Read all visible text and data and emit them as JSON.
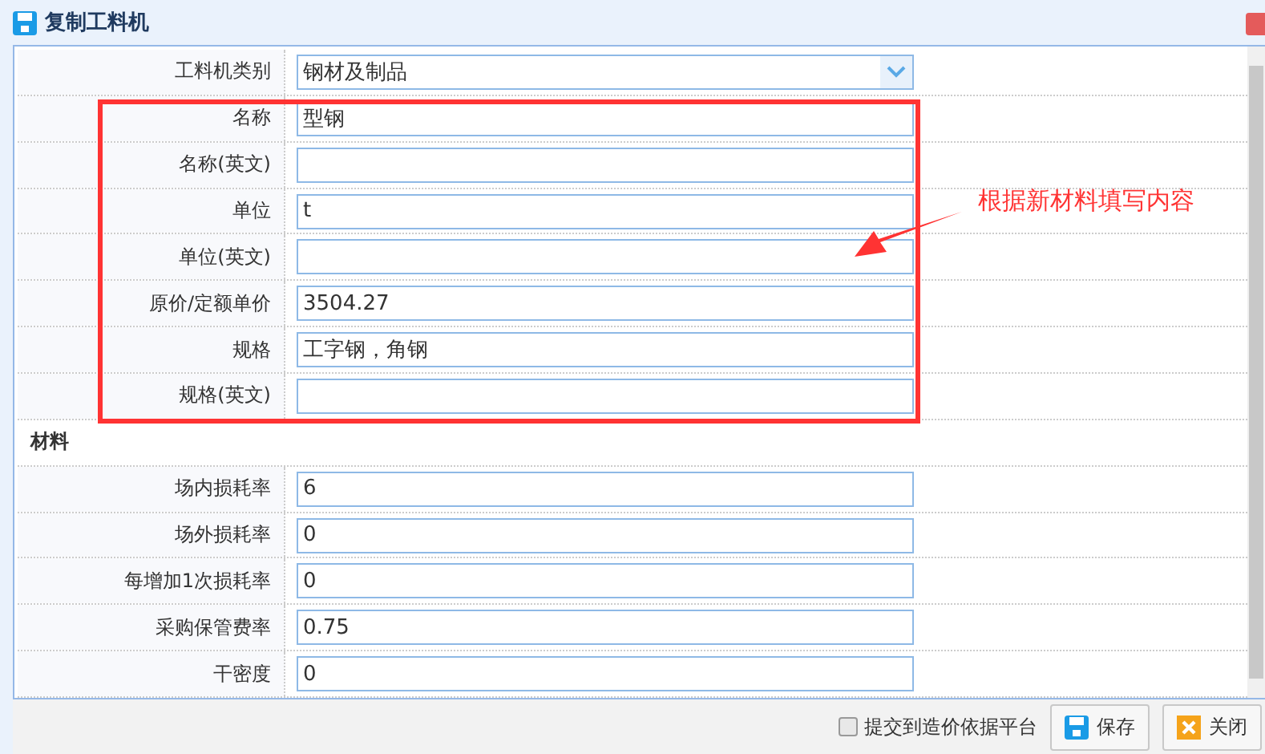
{
  "window": {
    "title": "复制工料机"
  },
  "form": {
    "category": {
      "label": "工料机类别",
      "value": "钢材及制品"
    },
    "fields": [
      {
        "label": "名称",
        "value": "型钢"
      },
      {
        "label": "名称(英文)"
      },
      {
        "label": "单位",
        "value": "t"
      },
      {
        "label": "单位(英文)"
      },
      {
        "label": "原价/定额单价",
        "value": "3504.27"
      },
      {
        "label": "规格",
        "value": "工字钢，角钢"
      },
      {
        "label": "规格(英文)"
      }
    ],
    "section": "材料",
    "material_fields": [
      {
        "label": "场内损耗率",
        "value": "6"
      },
      {
        "label": "场外损耗率",
        "value": "0"
      },
      {
        "label": "每增加1次损耗率",
        "value": "0"
      },
      {
        "label": "采购保管费率",
        "value": "0.75"
      },
      {
        "label": "干密度",
        "value": "0"
      }
    ]
  },
  "annotation": {
    "text": "根据新材料填写内容"
  },
  "footer": {
    "submit": {
      "label": "提交到造价依据平台",
      "checked": false
    },
    "buttons": [
      {
        "kind": "save",
        "label": "保存"
      },
      {
        "kind": "close",
        "label": "关闭"
      }
    ]
  }
}
